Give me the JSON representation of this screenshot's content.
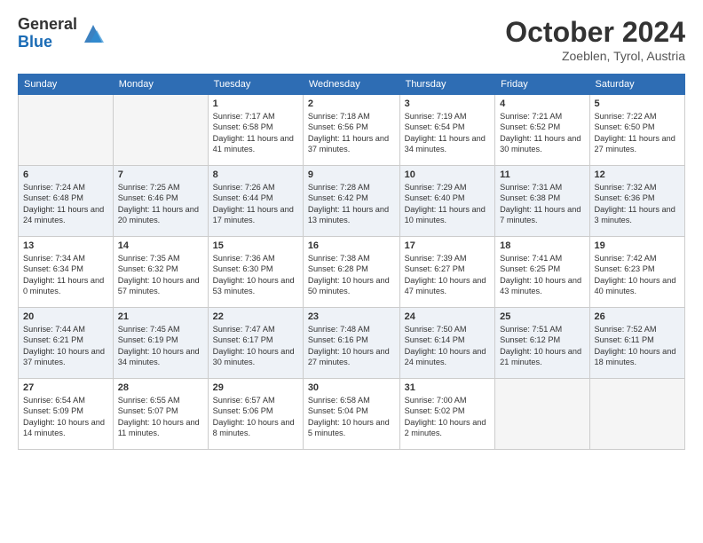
{
  "logo": {
    "general": "General",
    "blue": "Blue"
  },
  "title": "October 2024",
  "location": "Zoeblen, Tyrol, Austria",
  "headers": [
    "Sunday",
    "Monday",
    "Tuesday",
    "Wednesday",
    "Thursday",
    "Friday",
    "Saturday"
  ],
  "rows": [
    {
      "alt": false,
      "cells": [
        {
          "empty": true,
          "day": "",
          "detail": ""
        },
        {
          "empty": true,
          "day": "",
          "detail": ""
        },
        {
          "empty": false,
          "day": "1",
          "detail": "Sunrise: 7:17 AM\nSunset: 6:58 PM\nDaylight: 11 hours and 41 minutes."
        },
        {
          "empty": false,
          "day": "2",
          "detail": "Sunrise: 7:18 AM\nSunset: 6:56 PM\nDaylight: 11 hours and 37 minutes."
        },
        {
          "empty": false,
          "day": "3",
          "detail": "Sunrise: 7:19 AM\nSunset: 6:54 PM\nDaylight: 11 hours and 34 minutes."
        },
        {
          "empty": false,
          "day": "4",
          "detail": "Sunrise: 7:21 AM\nSunset: 6:52 PM\nDaylight: 11 hours and 30 minutes."
        },
        {
          "empty": false,
          "day": "5",
          "detail": "Sunrise: 7:22 AM\nSunset: 6:50 PM\nDaylight: 11 hours and 27 minutes."
        }
      ]
    },
    {
      "alt": true,
      "cells": [
        {
          "empty": false,
          "day": "6",
          "detail": "Sunrise: 7:24 AM\nSunset: 6:48 PM\nDaylight: 11 hours and 24 minutes."
        },
        {
          "empty": false,
          "day": "7",
          "detail": "Sunrise: 7:25 AM\nSunset: 6:46 PM\nDaylight: 11 hours and 20 minutes."
        },
        {
          "empty": false,
          "day": "8",
          "detail": "Sunrise: 7:26 AM\nSunset: 6:44 PM\nDaylight: 11 hours and 17 minutes."
        },
        {
          "empty": false,
          "day": "9",
          "detail": "Sunrise: 7:28 AM\nSunset: 6:42 PM\nDaylight: 11 hours and 13 minutes."
        },
        {
          "empty": false,
          "day": "10",
          "detail": "Sunrise: 7:29 AM\nSunset: 6:40 PM\nDaylight: 11 hours and 10 minutes."
        },
        {
          "empty": false,
          "day": "11",
          "detail": "Sunrise: 7:31 AM\nSunset: 6:38 PM\nDaylight: 11 hours and 7 minutes."
        },
        {
          "empty": false,
          "day": "12",
          "detail": "Sunrise: 7:32 AM\nSunset: 6:36 PM\nDaylight: 11 hours and 3 minutes."
        }
      ]
    },
    {
      "alt": false,
      "cells": [
        {
          "empty": false,
          "day": "13",
          "detail": "Sunrise: 7:34 AM\nSunset: 6:34 PM\nDaylight: 11 hours and 0 minutes."
        },
        {
          "empty": false,
          "day": "14",
          "detail": "Sunrise: 7:35 AM\nSunset: 6:32 PM\nDaylight: 10 hours and 57 minutes."
        },
        {
          "empty": false,
          "day": "15",
          "detail": "Sunrise: 7:36 AM\nSunset: 6:30 PM\nDaylight: 10 hours and 53 minutes."
        },
        {
          "empty": false,
          "day": "16",
          "detail": "Sunrise: 7:38 AM\nSunset: 6:28 PM\nDaylight: 10 hours and 50 minutes."
        },
        {
          "empty": false,
          "day": "17",
          "detail": "Sunrise: 7:39 AM\nSunset: 6:27 PM\nDaylight: 10 hours and 47 minutes."
        },
        {
          "empty": false,
          "day": "18",
          "detail": "Sunrise: 7:41 AM\nSunset: 6:25 PM\nDaylight: 10 hours and 43 minutes."
        },
        {
          "empty": false,
          "day": "19",
          "detail": "Sunrise: 7:42 AM\nSunset: 6:23 PM\nDaylight: 10 hours and 40 minutes."
        }
      ]
    },
    {
      "alt": true,
      "cells": [
        {
          "empty": false,
          "day": "20",
          "detail": "Sunrise: 7:44 AM\nSunset: 6:21 PM\nDaylight: 10 hours and 37 minutes."
        },
        {
          "empty": false,
          "day": "21",
          "detail": "Sunrise: 7:45 AM\nSunset: 6:19 PM\nDaylight: 10 hours and 34 minutes."
        },
        {
          "empty": false,
          "day": "22",
          "detail": "Sunrise: 7:47 AM\nSunset: 6:17 PM\nDaylight: 10 hours and 30 minutes."
        },
        {
          "empty": false,
          "day": "23",
          "detail": "Sunrise: 7:48 AM\nSunset: 6:16 PM\nDaylight: 10 hours and 27 minutes."
        },
        {
          "empty": false,
          "day": "24",
          "detail": "Sunrise: 7:50 AM\nSunset: 6:14 PM\nDaylight: 10 hours and 24 minutes."
        },
        {
          "empty": false,
          "day": "25",
          "detail": "Sunrise: 7:51 AM\nSunset: 6:12 PM\nDaylight: 10 hours and 21 minutes."
        },
        {
          "empty": false,
          "day": "26",
          "detail": "Sunrise: 7:52 AM\nSunset: 6:11 PM\nDaylight: 10 hours and 18 minutes."
        }
      ]
    },
    {
      "alt": false,
      "cells": [
        {
          "empty": false,
          "day": "27",
          "detail": "Sunrise: 6:54 AM\nSunset: 5:09 PM\nDaylight: 10 hours and 14 minutes."
        },
        {
          "empty": false,
          "day": "28",
          "detail": "Sunrise: 6:55 AM\nSunset: 5:07 PM\nDaylight: 10 hours and 11 minutes."
        },
        {
          "empty": false,
          "day": "29",
          "detail": "Sunrise: 6:57 AM\nSunset: 5:06 PM\nDaylight: 10 hours and 8 minutes."
        },
        {
          "empty": false,
          "day": "30",
          "detail": "Sunrise: 6:58 AM\nSunset: 5:04 PM\nDaylight: 10 hours and 5 minutes."
        },
        {
          "empty": false,
          "day": "31",
          "detail": "Sunrise: 7:00 AM\nSunset: 5:02 PM\nDaylight: 10 hours and 2 minutes."
        },
        {
          "empty": true,
          "day": "",
          "detail": ""
        },
        {
          "empty": true,
          "day": "",
          "detail": ""
        }
      ]
    }
  ]
}
